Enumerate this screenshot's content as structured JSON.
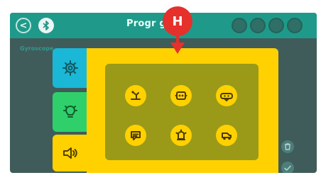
{
  "header": {
    "title": "Progr g",
    "back_icon": "chevron-left-icon",
    "bluetooth_icon": "bluetooth-icon",
    "right_buttons": [
      "status-dot-1",
      "status-dot-2",
      "status-dot-3",
      "status-dot-4"
    ]
  },
  "subheader": {
    "label": "Gyroscope"
  },
  "tabs": [
    {
      "name": "settings",
      "icon": "gear-icon",
      "color": "#1bb7d6"
    },
    {
      "name": "light",
      "icon": "lightbulb-icon",
      "color": "#2fd06b"
    },
    {
      "name": "sound",
      "icon": "speaker-icon",
      "color": "#ffd100"
    }
  ],
  "actions": [
    {
      "name": "robot-arm",
      "icon": "robot-arm-icon"
    },
    {
      "name": "robot-face",
      "icon": "robot-face-icon"
    },
    {
      "name": "vr-headset",
      "icon": "vr-headset-icon"
    },
    {
      "name": "speech",
      "icon": "speech-bubble-icon"
    },
    {
      "name": "alarm",
      "icon": "alarm-light-icon"
    },
    {
      "name": "vehicle",
      "icon": "vehicle-icon"
    }
  ],
  "right_controls": [
    {
      "name": "trash",
      "icon": "trash-icon"
    },
    {
      "name": "confirm",
      "icon": "check-icon"
    }
  ],
  "badge": {
    "label": "H",
    "color": "#e5302b"
  }
}
